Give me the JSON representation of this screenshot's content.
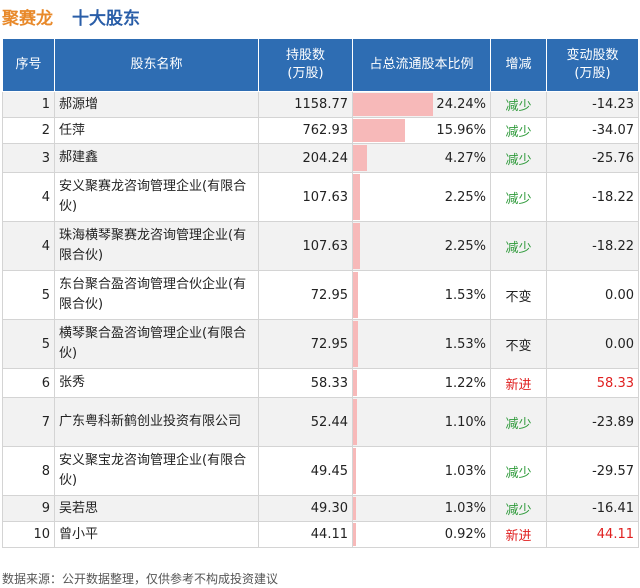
{
  "header": {
    "company": "聚赛龙",
    "section": "十大股东"
  },
  "columns": [
    "序号",
    "股东名称",
    "持股数\n(万股)",
    "占总流通股本比例",
    "增减",
    "变动股数\n(万股)"
  ],
  "rows": [
    {
      "rank": "1",
      "name": "郝源增",
      "shares": "1158.77",
      "ratio": "24.24%",
      "ratio_value": 24.24,
      "change": "减少",
      "change_type": "down",
      "delta": "-14.23"
    },
    {
      "rank": "2",
      "name": "任萍",
      "shares": "762.93",
      "ratio": "15.96%",
      "ratio_value": 15.96,
      "change": "减少",
      "change_type": "down",
      "delta": "-34.07"
    },
    {
      "rank": "3",
      "name": "郝建鑫",
      "shares": "204.24",
      "ratio": "4.27%",
      "ratio_value": 4.27,
      "change": "减少",
      "change_type": "down",
      "delta": "-25.76"
    },
    {
      "rank": "4",
      "name": "安义聚赛龙咨询管理企业(有限合伙)",
      "shares": "107.63",
      "ratio": "2.25%",
      "ratio_value": 2.25,
      "change": "减少",
      "change_type": "down",
      "delta": "-18.22"
    },
    {
      "rank": "4",
      "name": "珠海横琴聚赛龙咨询管理企业(有限合伙)",
      "shares": "107.63",
      "ratio": "2.25%",
      "ratio_value": 2.25,
      "change": "减少",
      "change_type": "down",
      "delta": "-18.22"
    },
    {
      "rank": "5",
      "name": "东台聚合盈咨询管理合伙企业(有限合伙)",
      "shares": "72.95",
      "ratio": "1.53%",
      "ratio_value": 1.53,
      "change": "不变",
      "change_type": "flat",
      "delta": "0.00"
    },
    {
      "rank": "5",
      "name": "横琴聚合盈咨询管理企业(有限合伙)",
      "shares": "72.95",
      "ratio": "1.53%",
      "ratio_value": 1.53,
      "change": "不变",
      "change_type": "flat",
      "delta": "0.00"
    },
    {
      "rank": "6",
      "name": "张秀",
      "shares": "58.33",
      "ratio": "1.22%",
      "ratio_value": 1.22,
      "change": "新进",
      "change_type": "up",
      "delta": "58.33"
    },
    {
      "rank": "7",
      "name": "广东粤科新鹤创业投资有限公司",
      "shares": "52.44",
      "ratio": "1.10%",
      "ratio_value": 1.1,
      "change": "减少",
      "change_type": "down",
      "delta": "-23.89"
    },
    {
      "rank": "8",
      "name": "安义聚宝龙咨询管理企业(有限合伙)",
      "shares": "49.45",
      "ratio": "1.03%",
      "ratio_value": 1.03,
      "change": "减少",
      "change_type": "down",
      "delta": "-29.57"
    },
    {
      "rank": "9",
      "name": "吴若思",
      "shares": "49.30",
      "ratio": "1.03%",
      "ratio_value": 1.03,
      "change": "减少",
      "change_type": "down",
      "delta": "-16.41"
    },
    {
      "rank": "10",
      "name": "曾小平",
      "shares": "44.11",
      "ratio": "0.92%",
      "ratio_value": 0.92,
      "change": "新进",
      "change_type": "up",
      "delta": "44.11"
    }
  ],
  "colors": {
    "header_bg": "#2e6db3",
    "bar": "#f7b9b9",
    "down": "#2e9a3a",
    "up": "#e02020",
    "company": "#e8892a",
    "section": "#2a5ea8"
  },
  "footer": {
    "text": "数据来源：公开数据整理，仅供参考不构成投资建议"
  }
}
